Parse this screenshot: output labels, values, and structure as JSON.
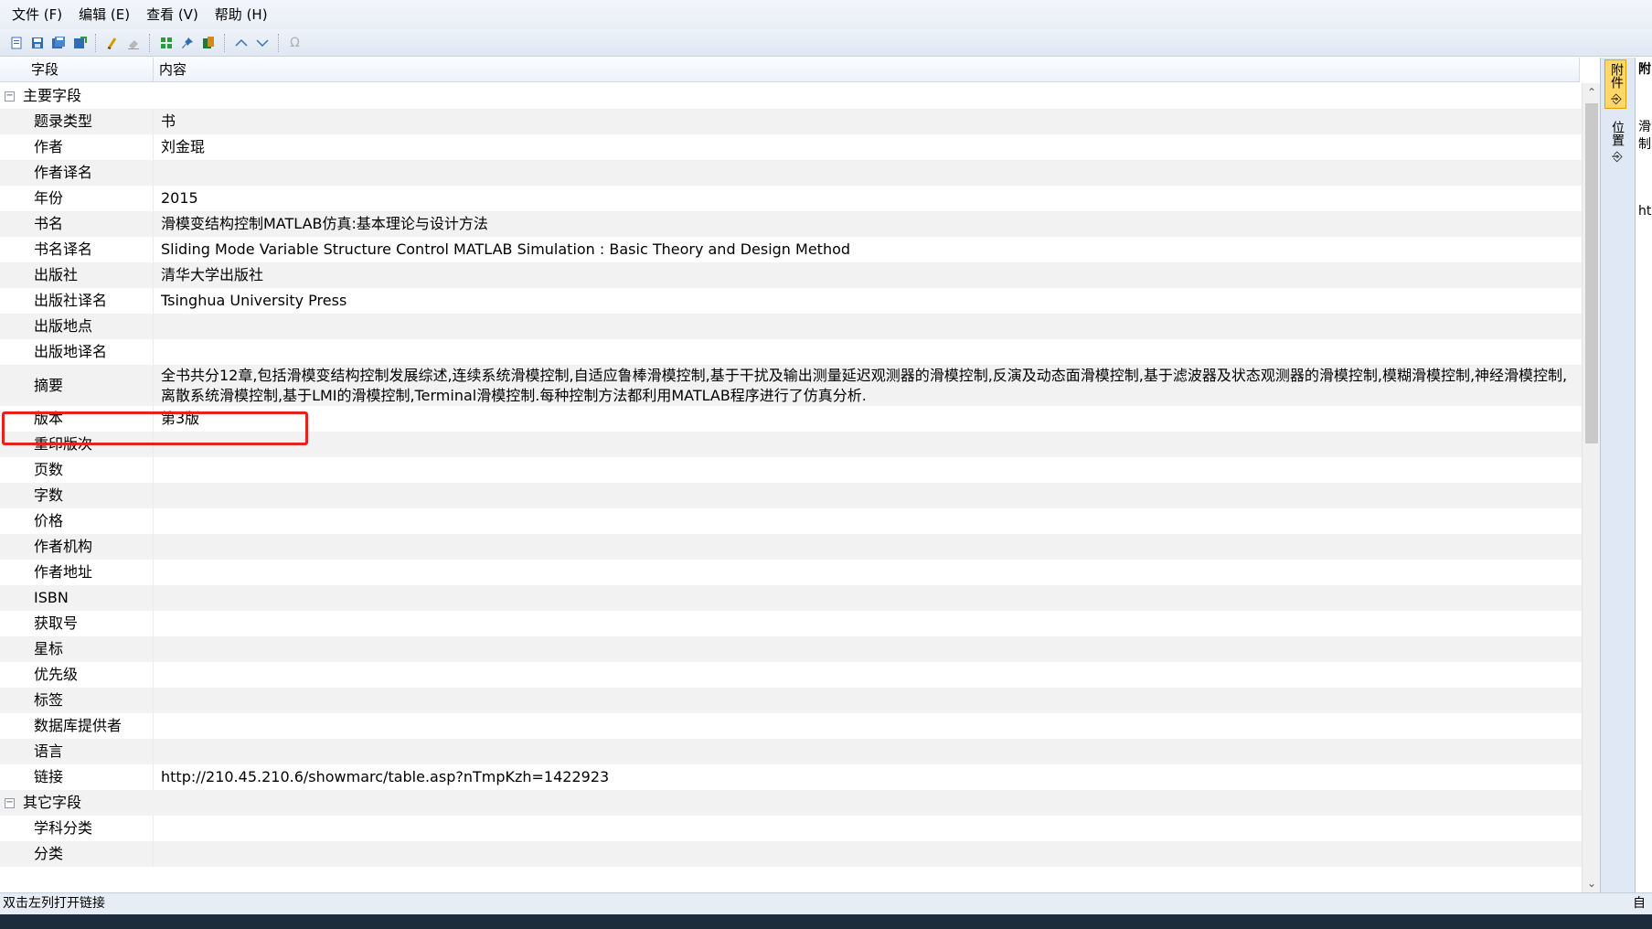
{
  "menu": [
    "文件 (F)",
    "编辑 (E)",
    "查看 (V)",
    "帮助 (H)"
  ],
  "toolbar": {
    "icons": [
      "new-icon",
      "save-icon",
      "save-all-icon",
      "export-icon",
      "clear-icon",
      "erase-icon",
      "grid-icon",
      "pin-icon",
      "book-icon",
      "up-icon",
      "down-icon",
      "omega-icon"
    ]
  },
  "grid": {
    "header": {
      "field": "字段",
      "content": "内容"
    },
    "groups": [
      {
        "label": "主要字段",
        "rows": [
          {
            "name": "题录类型",
            "value": "书"
          },
          {
            "name": "作者",
            "value": "刘金琨"
          },
          {
            "name": "作者译名",
            "value": ""
          },
          {
            "name": "年份",
            "value": "2015"
          },
          {
            "name": "书名",
            "value": "滑模变结构控制MATLAB仿真:基本理论与设计方法"
          },
          {
            "name": "书名译名",
            "value": "Sliding Mode Variable Structure Control MATLAB Simulation : Basic Theory and Design Method"
          },
          {
            "name": "出版社",
            "value": "清华大学出版社"
          },
          {
            "name": "出版社译名",
            "value": "Tsinghua University Press"
          },
          {
            "name": "出版地点",
            "value": ""
          },
          {
            "name": "出版地译名",
            "value": ""
          },
          {
            "name": "摘要",
            "value": "全书共分12章,包括滑模变结构控制发展综述,连续系统滑模控制,自适应鲁棒滑模控制,基于干扰及输出测量延迟观测器的滑模控制,反演及动态面滑模控制,基于滤波器及状态观测器的滑模控制,模糊滑模控制,神经滑模控制,离散系统滑模控制,基于LMI的滑模控制,Terminal滑模控制.每种控制方法都利用MATLAB程序进行了仿真分析."
          },
          {
            "name": "版本",
            "value": "第3版"
          },
          {
            "name": "重印版次",
            "value": ""
          },
          {
            "name": "页数",
            "value": ""
          },
          {
            "name": "字数",
            "value": ""
          },
          {
            "name": "价格",
            "value": ""
          },
          {
            "name": "作者机构",
            "value": ""
          },
          {
            "name": "作者地址",
            "value": ""
          },
          {
            "name": "ISBN",
            "value": ""
          },
          {
            "name": "获取号",
            "value": ""
          },
          {
            "name": "星标",
            "value": ""
          },
          {
            "name": "优先级",
            "value": ""
          },
          {
            "name": "标签",
            "value": ""
          },
          {
            "name": "数据库提供者",
            "value": ""
          },
          {
            "name": "语言",
            "value": ""
          },
          {
            "name": "链接",
            "value": "http://210.45.210.6/showmarc/table.asp?nTmpKzh=1422923"
          }
        ]
      },
      {
        "label": "其它字段",
        "rows": [
          {
            "name": "学科分类",
            "value": ""
          },
          {
            "name": "分类",
            "value": ""
          }
        ]
      }
    ]
  },
  "side_panel": {
    "tabs": [
      "附件",
      "位置"
    ],
    "content": [
      "附",
      "滑",
      "制",
      "ht"
    ]
  },
  "statusbar": {
    "text": "双击左列打开链接",
    "right": "自"
  }
}
